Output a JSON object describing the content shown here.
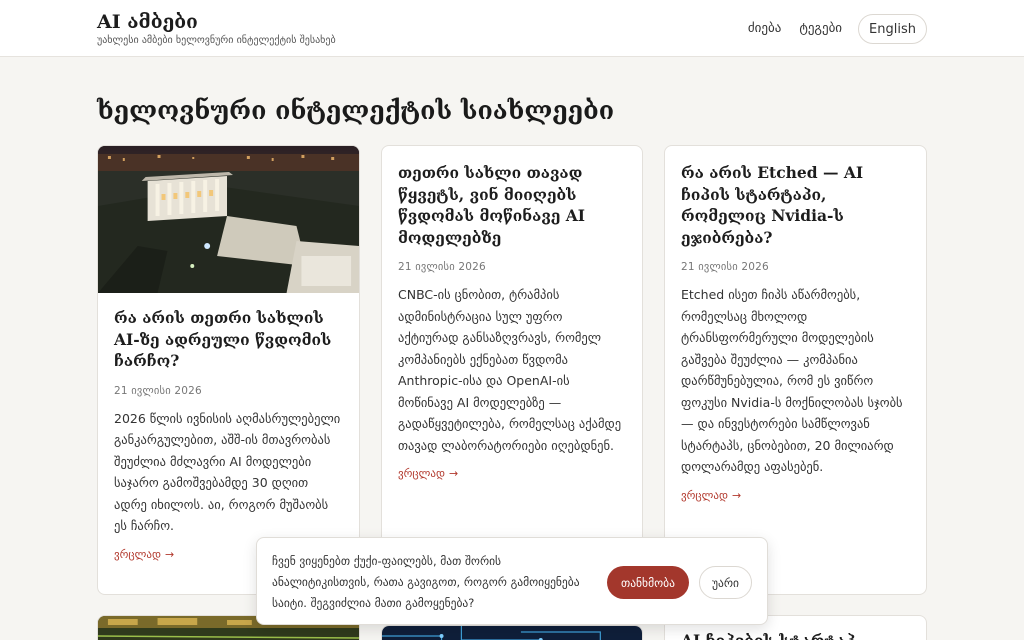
{
  "header": {
    "site_title": "AI ამბები",
    "site_subtitle": "უახლესი ამბები ხელოვნური ინტელექტის შესახებ",
    "nav": {
      "search": "ძიება",
      "tags": "ტეგები",
      "language": "English"
    }
  },
  "main": {
    "title": "ხელოვნური ინტელექტის სიახლეები",
    "articles": [
      {
        "title": "რა არის თეთრი სახლის AI-ზე ადრეული წვდომის ჩარჩო?",
        "date": "21 ივლისი 2026",
        "excerpt": "2026 წლის ივნისის აღმასრულებელი განკარგულებით, აშშ-ის მთავრობას შეუძლია მძლავრი AI მოდელები საჯარო გამოშვებამდე 30 დღით ადრე იხილოს. აი, როგორ მუშაობს ეს ჩარჩო.",
        "read_more": "ვრცლად",
        "arrow": "→",
        "image": "white-house-night-photo"
      },
      {
        "title": "თეთრი სახლი თავად წყვეტს, ვინ მიიღებს წვდომას მოწინავე AI მოდელებზე",
        "date": "21 ივლისი 2026",
        "excerpt": "CNBC-ის ცნობით, ტრამპის ადმინისტრაცია სულ უფრო აქტიურად განსაზღვრავს, რომელ კომპანიებს ექნებათ წვდომა Anthropic-ისა და OpenAI-ის მოწინავე AI მოდელებზე — გადაწყვეტილება, რომელსაც აქამდე თავად ლაბორატორიები იღებდნენ.",
        "read_more": "ვრცლად",
        "arrow": "→"
      },
      {
        "title": "რა არის Etched — AI ჩიპის სტარტაპი, რომელიც Nvidia-ს ეჯიბრება?",
        "date": "21 ივლისი 2026",
        "excerpt": "Etched ისეთ ჩიპს აწარმოებს, რომელსაც მხოლოდ ტრანსფორმერული მოდელების გაშვება შეუძლია — კომპანია დარწმუნებულია, რომ ეს ვიწრო ფოკუსი Nvidia-ს მოქნილობას სჯობს — და ინვესტორები სამწლოვან სტარტაპს, ცნობებით, 20 მილიარდ დოლარამდე აფასებენ.",
        "read_more": "ვრცლად",
        "arrow": "→"
      },
      {
        "image": "circuit-board-photo"
      },
      {
        "image": "circuit-pattern-illustration"
      },
      {
        "title_partial": "AI ჩიპების სტარტაპ"
      }
    ]
  },
  "cookie_banner": {
    "text": "ჩვენ ვიყენებთ ქუქი-ფაილებს, მათ შორის ანალიტიკისთვის, რათა გავიგოთ, როგორ გამოიყენება საიტი. შეგვიძლია მათი გამოყენება?",
    "accept": "თანხმობა",
    "decline": "უარი"
  },
  "colors": {
    "accent": "#a3372c",
    "link": "#b2392d",
    "background": "#f6f5f2"
  }
}
